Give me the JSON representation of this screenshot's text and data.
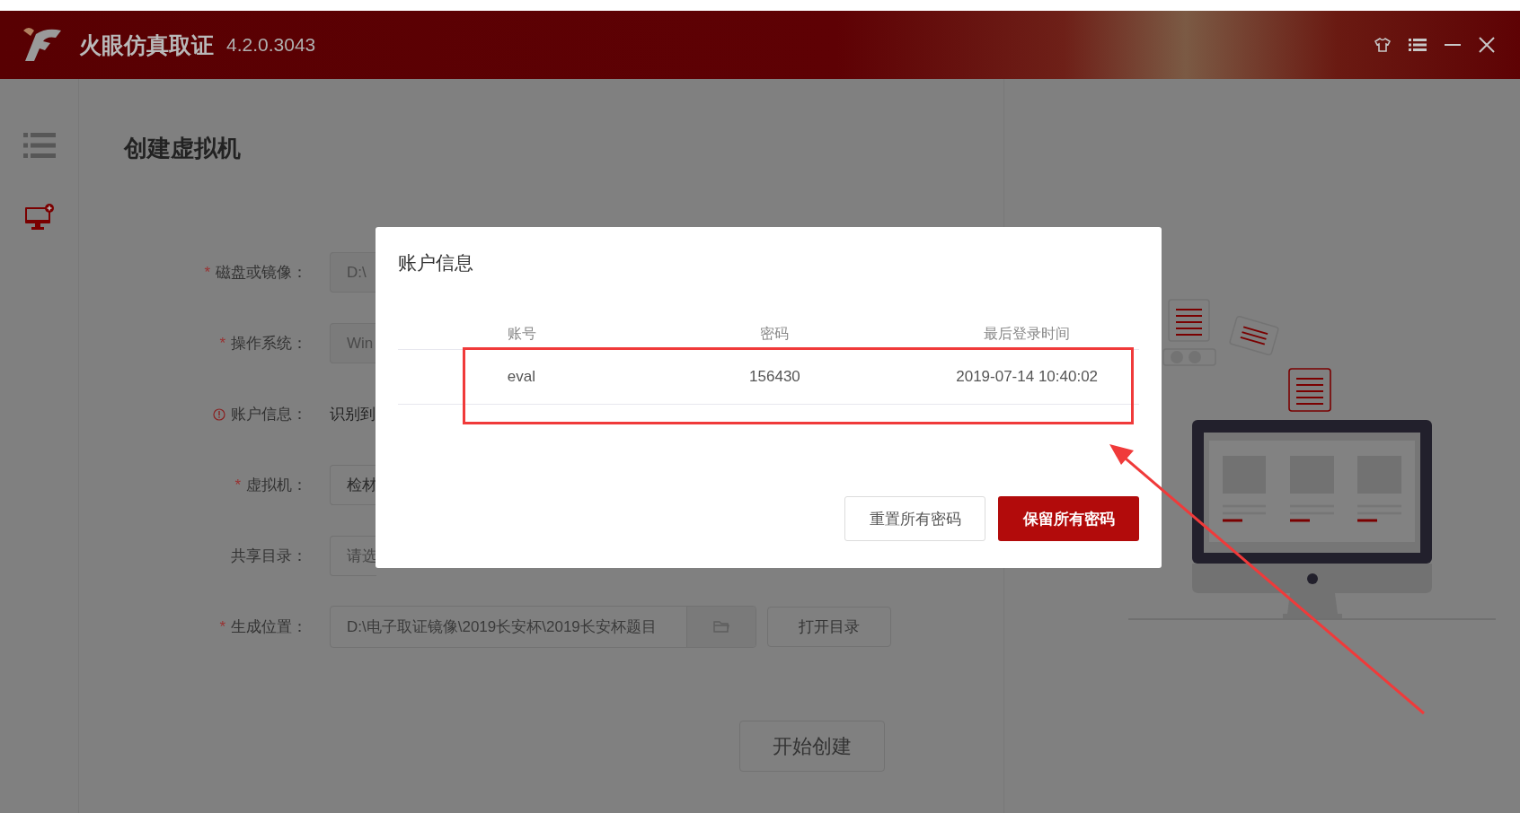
{
  "title_bar": {
    "app_name": "火眼仿真取证",
    "version": "4.2.0.3043"
  },
  "page": {
    "title": "创建虚拟机"
  },
  "form": [
    {
      "label": "磁盘或镜像：",
      "required_mark": "*",
      "kind": "input",
      "disabled": true,
      "value": "D:\\"
    },
    {
      "label": "操作系统：",
      "required_mark": "*",
      "kind": "input",
      "disabled": true,
      "value": "Win"
    },
    {
      "label": "账户信息：",
      "kind": "info",
      "value": "识别到"
    },
    {
      "label": "虚拟机：",
      "required_mark": "*",
      "kind": "input",
      "value": "检材"
    },
    {
      "label": "共享目录：",
      "kind": "input",
      "placeholder": "请选"
    }
  ],
  "output_row": {
    "label": "生成位置：",
    "required_mark": "*",
    "value": "D:\\电子取证镜像\\2019长安杯\\2019长安杯题目",
    "button": "打开目录"
  },
  "start_button": "开始创建",
  "dialog": {
    "title": "账户信息",
    "columns": [
      "账号",
      "密码",
      "最后登录时间"
    ],
    "rows": [
      [
        "eval",
        "156430",
        "2019-07-14 10:40:02"
      ]
    ],
    "buttons": [
      {
        "label": "重置所有密码",
        "kind": "default"
      },
      {
        "label": "保留所有密码",
        "kind": "primary"
      }
    ]
  }
}
